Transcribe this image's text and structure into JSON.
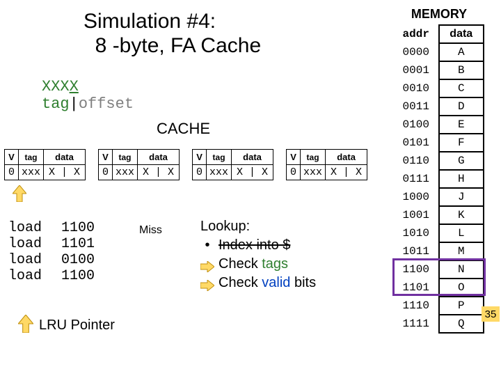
{
  "title_line1": "Simulation #4:",
  "title_line2": "8 -byte, FA Cache",
  "addrfmt": {
    "xxxa": "XXX",
    "xxxb": "X",
    "tag": "tag",
    "pipe": "|",
    "offset": "offset"
  },
  "cache_label": "CACHE",
  "cache_headers": {
    "v": "V",
    "tag": "tag",
    "data": "data"
  },
  "cache_row": {
    "v": "0",
    "tag": "xxx",
    "data": "X | X"
  },
  "loads": {
    "op": "load",
    "addrs": [
      "1100",
      "1101",
      "0100",
      "1100"
    ],
    "miss": "Miss"
  },
  "lookup": {
    "title": "Lookup:",
    "l1a": "Index into $",
    "l2": "Check ",
    "l2b": "tags",
    "l3": "Check ",
    "l3b": "valid",
    "l3c": " bits"
  },
  "lru_label": "LRU Pointer",
  "memory": {
    "title": "MEMORY",
    "headers": {
      "addr": "addr",
      "data": "data"
    },
    "rows": [
      {
        "addr": "0000",
        "data": "A"
      },
      {
        "addr": "0001",
        "data": "B"
      },
      {
        "addr": "0010",
        "data": "C"
      },
      {
        "addr": "0011",
        "data": "D"
      },
      {
        "addr": "0100",
        "data": "E"
      },
      {
        "addr": "0101",
        "data": "F"
      },
      {
        "addr": "0110",
        "data": "G"
      },
      {
        "addr": "0111",
        "data": "H"
      },
      {
        "addr": "1000",
        "data": "J"
      },
      {
        "addr": "1001",
        "data": "K"
      },
      {
        "addr": "1010",
        "data": "L"
      },
      {
        "addr": "1011",
        "data": "M"
      },
      {
        "addr": "1100",
        "data": "N"
      },
      {
        "addr": "1101",
        "data": "O"
      },
      {
        "addr": "1110",
        "data": "P"
      },
      {
        "addr": "1111",
        "data": "Q"
      }
    ]
  },
  "slide_num": "35",
  "colors": {
    "tag": "#2f7f2f",
    "offset": "#7f7f7f",
    "miss": "#a04040",
    "valid": "#0040c0",
    "highlight": "#7030a0"
  }
}
